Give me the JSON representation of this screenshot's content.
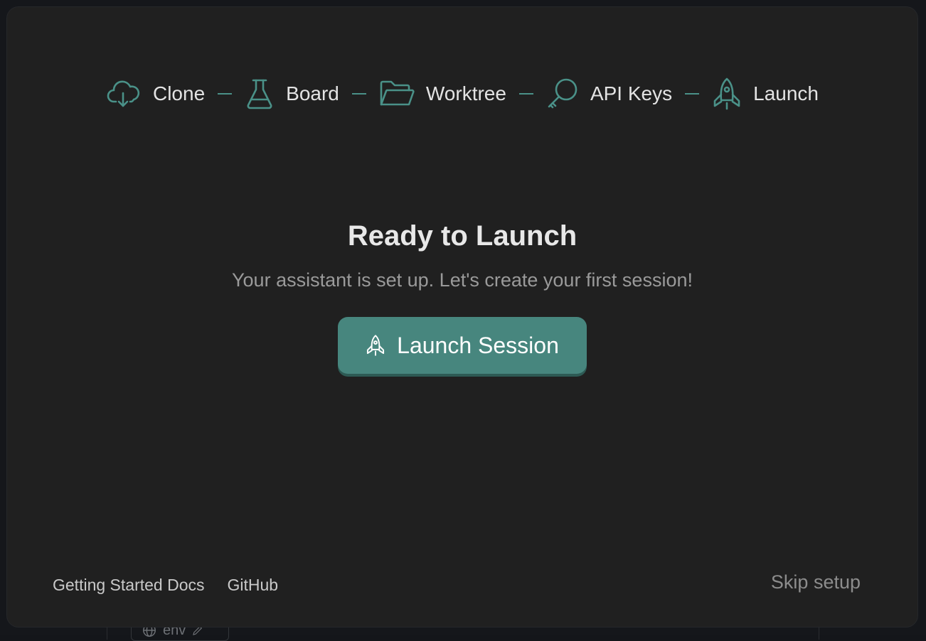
{
  "steps": [
    {
      "label": "Clone",
      "icon": "cloud-download-icon"
    },
    {
      "label": "Board",
      "icon": "flask-icon"
    },
    {
      "label": "Worktree",
      "icon": "folder-open-icon"
    },
    {
      "label": "API Keys",
      "icon": "key-icon"
    },
    {
      "label": "Launch",
      "icon": "rocket-icon"
    }
  ],
  "main": {
    "title": "Ready to Launch",
    "subtitle": "Your assistant is set up. Let's create your first session!",
    "launch_button": "Launch Session"
  },
  "footer": {
    "docs_link": "Getting Started Docs",
    "github_link": "GitHub",
    "skip": "Skip setup"
  },
  "background": {
    "chip_label": "env"
  },
  "colors": {
    "accent": "#47867e",
    "icon_accent": "#4a9188",
    "modal_bg": "#202020",
    "page_bg": "#15171b"
  }
}
